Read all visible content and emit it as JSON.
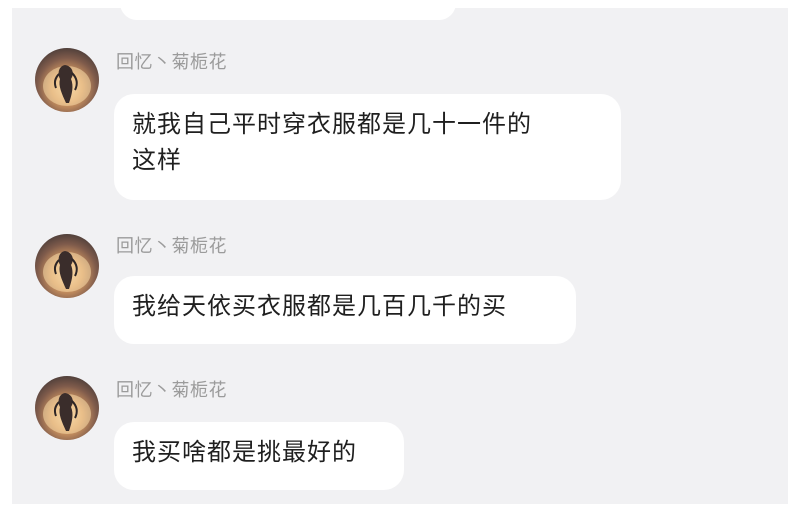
{
  "chat": {
    "messages": [
      {
        "sender": "回忆丶菊栀花",
        "text": "就我自己平时穿衣服都是几十一件的\n这样"
      },
      {
        "sender": "回忆丶菊栀花",
        "text": "我给天依买衣服都是几百几千的买"
      },
      {
        "sender": "回忆丶菊栀花",
        "text": "我买啥都是挑最好的"
      }
    ]
  }
}
